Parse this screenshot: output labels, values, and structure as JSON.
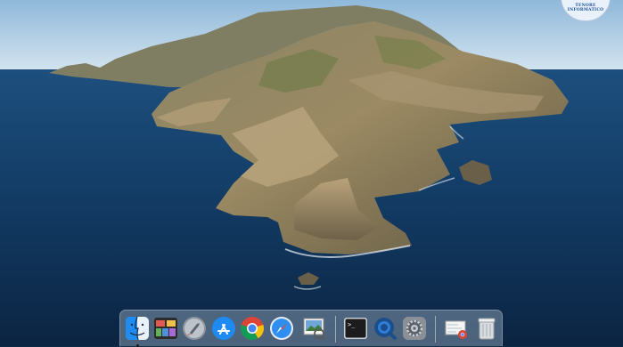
{
  "wallpaper": {
    "name": "macOS Catalina",
    "sea_color": "#123a63",
    "sky_color": "#bcd6ea"
  },
  "watermark": {
    "line1": "TENORE",
    "line2": "INFORMATICO"
  },
  "dock": {
    "apps": [
      {
        "name": "Finder",
        "icon": "finder-icon",
        "running": true
      },
      {
        "name": "Mission Control",
        "icon": "mission-control-icon",
        "running": false
      },
      {
        "name": "Launchpad",
        "icon": "launchpad-icon",
        "running": false
      },
      {
        "name": "App Store",
        "icon": "app-store-icon",
        "running": false
      },
      {
        "name": "Google Chrome",
        "icon": "chrome-icon",
        "running": false
      },
      {
        "name": "Safari",
        "icon": "safari-icon",
        "running": false
      },
      {
        "name": "Preview",
        "icon": "preview-icon",
        "running": false
      },
      {
        "name": "Terminal",
        "icon": "terminal-icon",
        "running": false
      },
      {
        "name": "QuickTime Player",
        "icon": "quicktime-icon",
        "running": false
      },
      {
        "name": "System Preferences",
        "icon": "system-preferences-icon",
        "running": false
      },
      {
        "name": "Downloads",
        "icon": "downloads-stack-icon",
        "running": false
      },
      {
        "name": "Trash",
        "icon": "trash-icon",
        "running": false
      }
    ],
    "terminal_prompt": ">_"
  }
}
